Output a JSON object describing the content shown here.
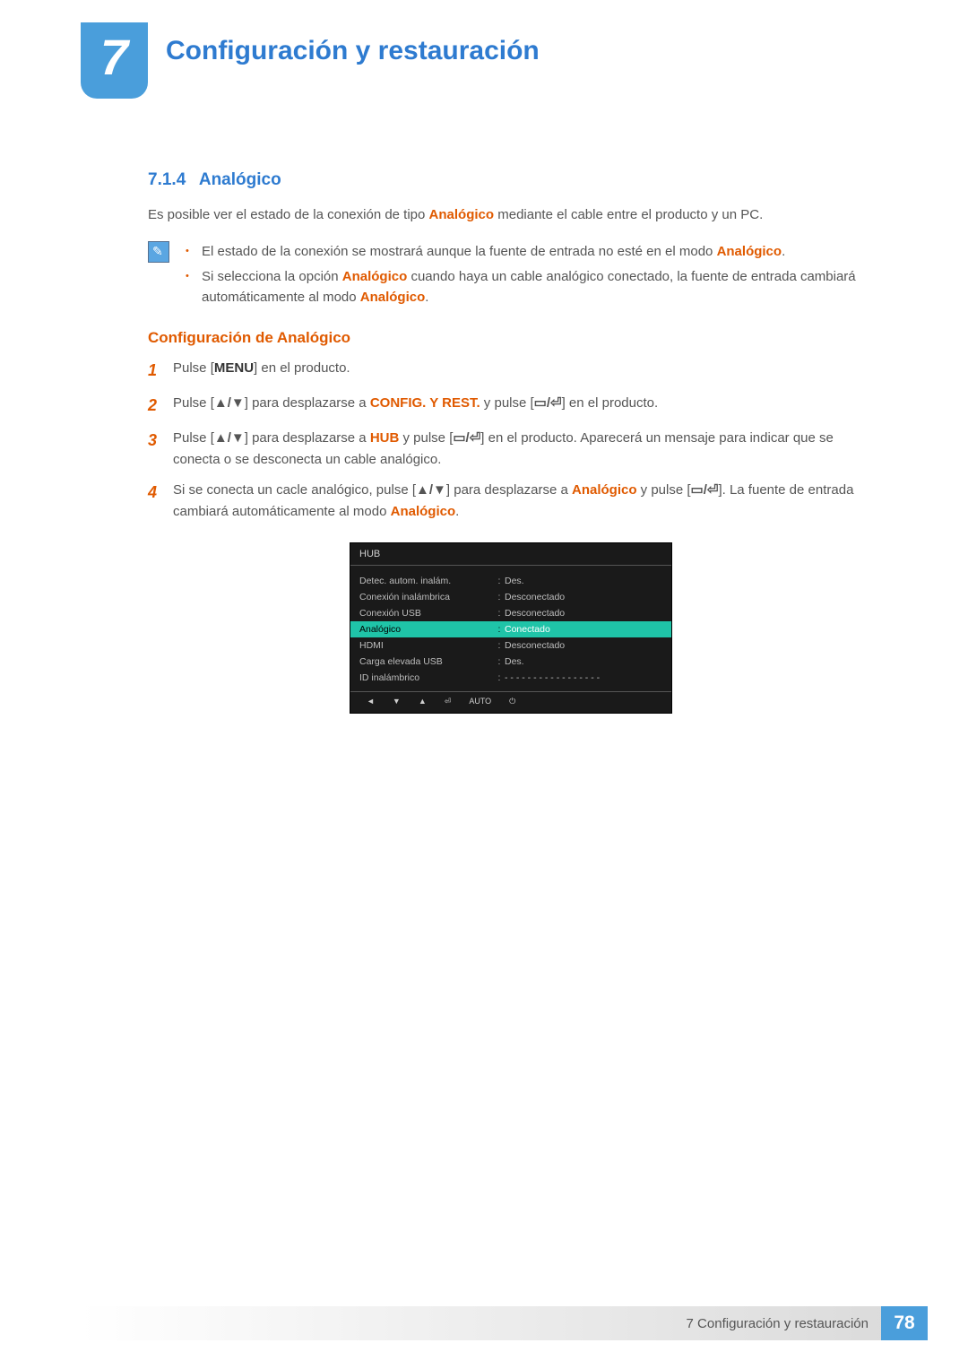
{
  "header": {
    "chapter_number": "7",
    "chapter_title": "Configuración y restauración"
  },
  "section": {
    "number": "7.1.4",
    "title": "Analógico"
  },
  "intro": {
    "pre": "Es posible ver el estado de la conexión de tipo ",
    "hl": "Analógico",
    "post": " mediante el cable entre el producto y un PC."
  },
  "notes": {
    "item1": {
      "pre": "El estado de la conexión se mostrará aunque la fuente de entrada no esté en el modo ",
      "hl": "Analógico",
      "post": "."
    },
    "item2": {
      "pre": "Si selecciona la opción ",
      "hl1": "Analógico",
      "mid": " cuando haya un cable analógico conectado, la fuente de entrada cambiará automáticamente al modo ",
      "hl2": "Analógico",
      "post": "."
    }
  },
  "sub_heading": "Configuración de Analógico",
  "steps": {
    "s1": {
      "n": "1",
      "a": "Pulse [",
      "b": "MENU",
      "c": "] en el producto."
    },
    "s2": {
      "n": "2",
      "a": "Pulse [",
      "nav": "▲/▼",
      "b": "] para desplazarse a ",
      "hl": "CONFIG. Y REST.",
      "c": " y pulse [",
      "ico": "▭/⏎",
      "d": "] en el producto."
    },
    "s3": {
      "n": "3",
      "a": "Pulse [",
      "nav": "▲/▼",
      "b": "] para desplazarse a ",
      "hl": "HUB",
      "c": " y pulse [",
      "ico": "▭/⏎",
      "d": "] en el producto. Aparecerá un mensaje para indicar que se conecta o se desconecta un cable analógico."
    },
    "s4": {
      "n": "4",
      "a": "Si se conecta un cacle analógico, pulse [",
      "nav": "▲/▼",
      "b": "] para desplazarse a ",
      "hl": "Analógico",
      "c": " y pulse [",
      "ico": "▭/⏎",
      "d": "]. La fuente de entrada cambiará automáticamente al modo ",
      "hl2": "Analógico",
      "e": "."
    }
  },
  "osd": {
    "title": "HUB",
    "rows": [
      {
        "label": "Detec. autom. inalám.",
        "value": "Des."
      },
      {
        "label": "Conexión inalámbrica",
        "value": "Desconectado"
      },
      {
        "label": "Conexión USB",
        "value": "Desconectado"
      },
      {
        "label": "Analógico",
        "value": "Conectado",
        "selected": true
      },
      {
        "label": "HDMI",
        "value": "Desconectado"
      },
      {
        "label": "Carga elevada USB",
        "value": "Des."
      },
      {
        "label": "ID inalámbrico",
        "value": "- - - - - - - - - - - - - - - - -"
      }
    ],
    "bottom_icons": [
      "◄",
      "▼",
      "▲",
      "⏎",
      "AUTO",
      "⏻"
    ]
  },
  "footer": {
    "text": "7 Configuración y restauración",
    "page": "78"
  }
}
